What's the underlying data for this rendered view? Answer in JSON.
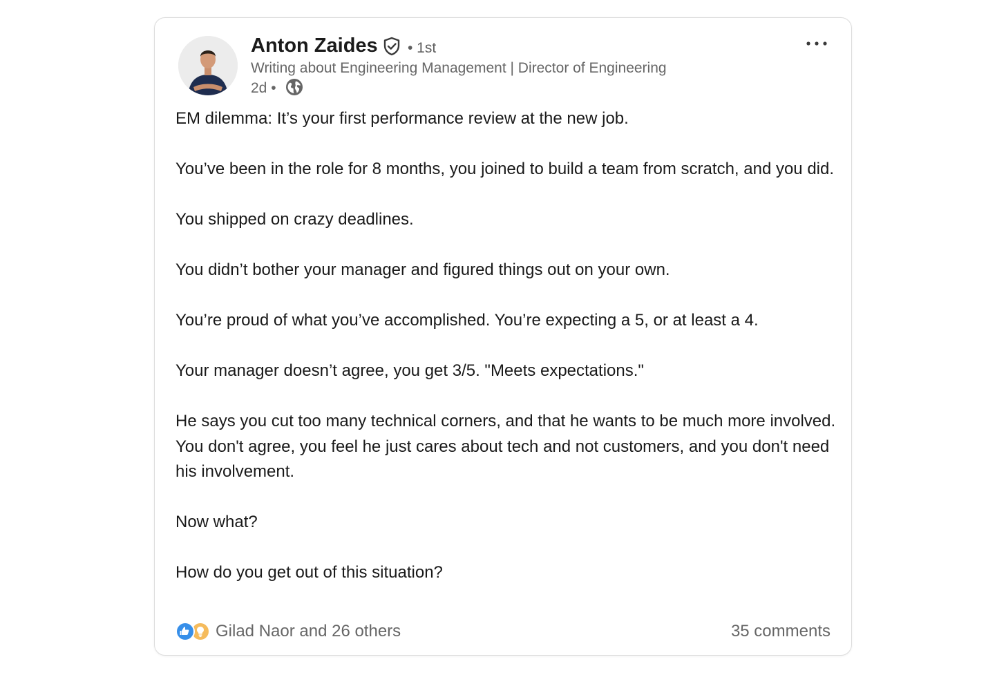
{
  "post": {
    "author": {
      "name": "Anton Zaides",
      "degree": "• 1st",
      "headline": "Writing about Engineering Management | Director of Engineering",
      "time": "2d •",
      "avatar": "avatar-photo",
      "verified_icon": "verified-shield-icon",
      "visibility_icon": "globe-icon"
    },
    "more_label": "…",
    "paragraphs": [
      "EM dilemma: It’s your first performance review at the new job.",
      "You’ve been in the role for 8 months, you joined to build a team from scratch, and you did.",
      "You shipped on crazy deadlines.",
      "You didn’t bother your manager and figured things out on your own.",
      "You’re proud of what you’ve accomplished. You’re expecting a 5, or at least a 4.",
      "Your manager doesn’t agree, you get 3/5. \"Meets expectations.\"",
      "He says you cut too many technical corners, and that he wants to be much more involved. You don't agree, you feel he just cares about tech and not customers, and you don't need his involvement.",
      "Now what?",
      "How do you get out of this situation?"
    ],
    "reactions": {
      "icons": [
        "like-icon",
        "insightful-icon"
      ],
      "text": "Gilad Naor and 26 others"
    },
    "comments": "35 comments"
  },
  "colors": {
    "like": "#378fe9",
    "insightful": "#f5bb5c",
    "secondary_text": "#666666"
  }
}
